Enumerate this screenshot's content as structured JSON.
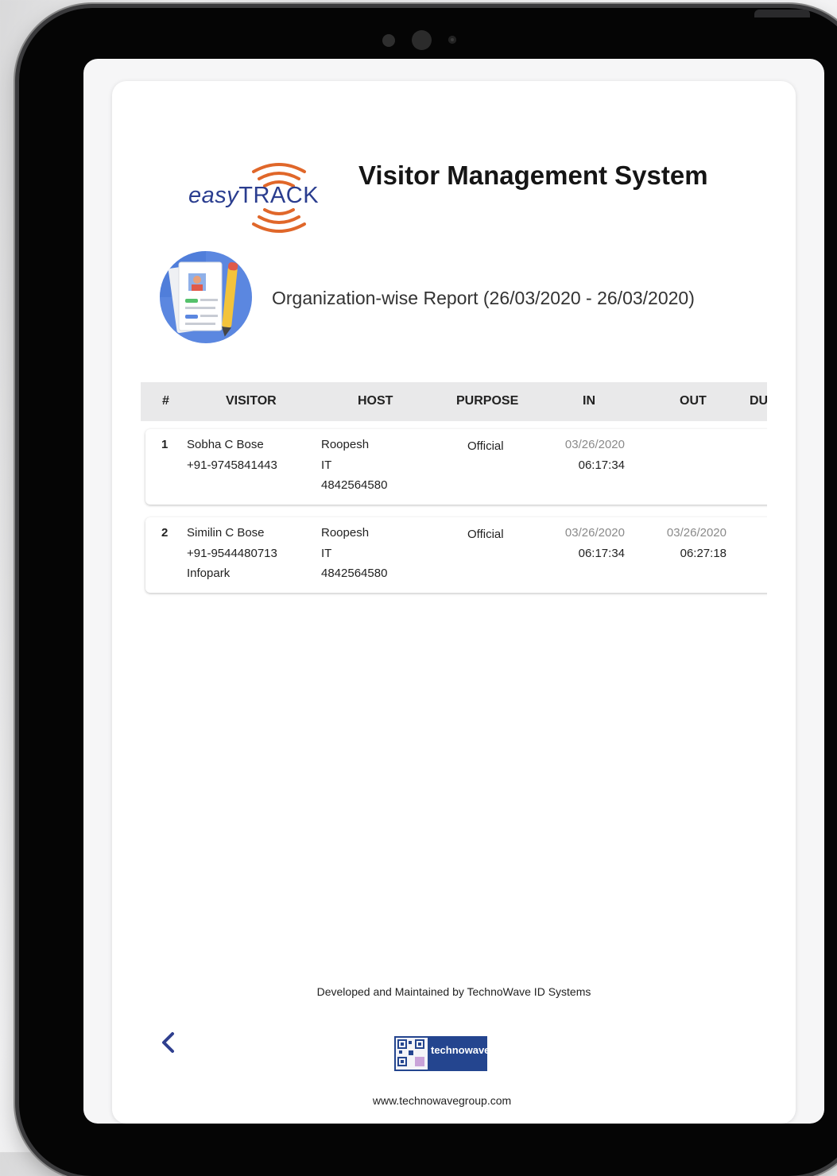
{
  "header": {
    "logo_easy": "easy",
    "logo_track": "TRACK",
    "title": "Visitor Management System"
  },
  "report": {
    "title": "Organization-wise Report (26/03/2020 - 26/03/2020)"
  },
  "table": {
    "columns": [
      "#",
      "VISITOR",
      "HOST",
      "PURPOSE",
      "IN",
      "OUT",
      "DU"
    ],
    "rows": [
      {
        "num": "1",
        "visitor": [
          "Sobha C Bose",
          "+91-9745841443",
          ""
        ],
        "host": [
          "Roopesh",
          "IT",
          "4842564580"
        ],
        "purpose": "Official",
        "in_date": "03/26/2020",
        "in_time": "06:17:34",
        "out_date": "",
        "out_time": ""
      },
      {
        "num": "2",
        "visitor": [
          "Similin C Bose",
          "+91-9544480713",
          "Infopark"
        ],
        "host": [
          "Roopesh",
          "IT",
          "4842564580"
        ],
        "purpose": "Official",
        "in_date": "03/26/2020",
        "in_time": "06:17:34",
        "out_date": "03/26/2020",
        "out_time": "06:27:18"
      }
    ]
  },
  "footer": {
    "developed_by": "Developed and Maintained by TechnoWave ID Systems",
    "brand": "technowave",
    "url": "www.technowavegroup.com",
    "back_icon": "chevron-left-icon"
  },
  "colors": {
    "logo_blue": "#2a3d8f",
    "logo_orange": "#e0672a",
    "back_blue": "#2f3f8f",
    "header_bg": "#e9e9ea"
  }
}
